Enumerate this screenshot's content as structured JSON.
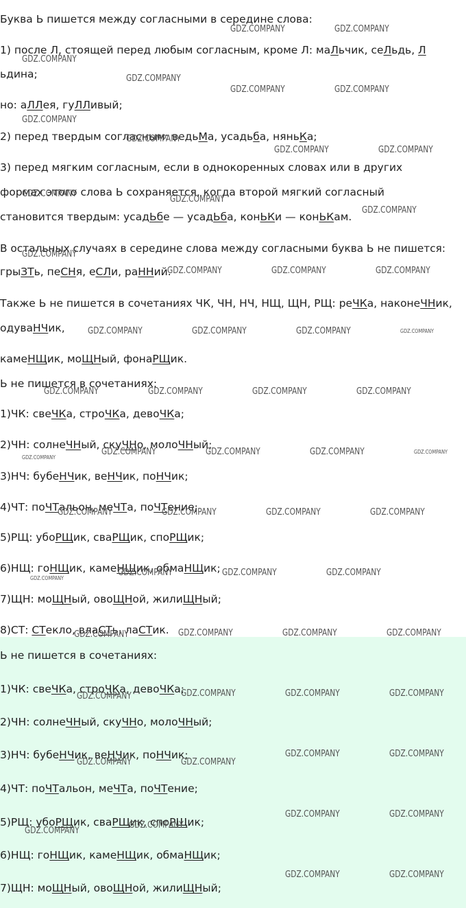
{
  "watermark": "GDZ.COMPANY",
  "lines": [
    [
      {
        "t": "Буква Ь пишется между согласными в середине слова:"
      }
    ],
    [
      {
        "t": "1) после Л, стоящей перед любым согласным, кроме Л: ма"
      },
      {
        "t": "Л",
        "u": 1
      },
      {
        "t": "ьчик, се"
      },
      {
        "t": "Л",
        "u": 1
      },
      {
        "t": "ьдь, "
      },
      {
        "t": "Л",
        "u": 1
      }
    ],
    [
      {
        "t": "ьдина;"
      }
    ],
    [
      {
        "t": "но: а"
      },
      {
        "t": "ЛЛ",
        "u": 1
      },
      {
        "t": "ея, гу"
      },
      {
        "t": "ЛЛ",
        "u": 1
      },
      {
        "t": "ивый;"
      }
    ],
    [
      {
        "t": "2) перед твердым согласным: ведь"
      },
      {
        "t": "М",
        "u": 1
      },
      {
        "t": "а, усадь"
      },
      {
        "t": "б",
        "u": 1
      },
      {
        "t": "а, нянь"
      },
      {
        "t": "К",
        "u": 1
      },
      {
        "t": "а;"
      }
    ],
    [
      {
        "t": "3) перед мягким согласным, если в однокоренных словах или в других"
      }
    ],
    [
      {
        "t": "формах этого слова Ь сохраняется, когда второй мягкий согласный"
      }
    ],
    [
      {
        "t": "становится твердым: усад"
      },
      {
        "t": "Ьб",
        "u": 1
      },
      {
        "t": "е — усад"
      },
      {
        "t": "Ьб",
        "u": 1
      },
      {
        "t": "а, кон"
      },
      {
        "t": "ЬК",
        "u": 1
      },
      {
        "t": "и — кон"
      },
      {
        "t": "ЬК",
        "u": 1
      },
      {
        "t": "ам."
      }
    ],
    [
      {
        "t": "В остальных случаях в середине слова между согласными буква Ь не пишется:"
      }
    ],
    [
      {
        "t": "гры"
      },
      {
        "t": "ЗТ",
        "u": 1
      },
      {
        "t": "ь, пе"
      },
      {
        "t": "СН",
        "u": 1
      },
      {
        "t": "я, е"
      },
      {
        "t": "СЛ",
        "u": 1
      },
      {
        "t": "и, ра"
      },
      {
        "t": "НН",
        "u": 1
      },
      {
        "t": "ий."
      }
    ],
    [
      {
        "t": "Также Ь не пишется в сочетаниях ЧК, ЧН, НЧ, НЩ, ЩН, РЩ: ре"
      },
      {
        "t": "ЧК",
        "u": 1
      },
      {
        "t": "а, наконе"
      },
      {
        "t": "ЧН",
        "u": 1
      },
      {
        "t": "ик,"
      }
    ],
    [
      {
        "t": "одува"
      },
      {
        "t": "НЧ",
        "u": 1
      },
      {
        "t": "ик,"
      }
    ],
    [
      {
        "t": "каме"
      },
      {
        "t": "НЩ",
        "u": 1
      },
      {
        "t": "ик, мо"
      },
      {
        "t": "ЩН",
        "u": 1
      },
      {
        "t": "ый, фона"
      },
      {
        "t": "РЩ",
        "u": 1
      },
      {
        "t": "ик."
      }
    ],
    [
      {
        "t": "Ь не пишется в сочетаниях:"
      }
    ],
    [
      {
        "t": "1)ЧК: све"
      },
      {
        "t": "ЧК",
        "u": 1
      },
      {
        "t": "а, стро"
      },
      {
        "t": "ЧК",
        "u": 1
      },
      {
        "t": "а, дево"
      },
      {
        "t": "ЧК",
        "u": 1
      },
      {
        "t": "а;"
      }
    ],
    [
      {
        "t": "2)ЧН: солне"
      },
      {
        "t": "ЧН",
        "u": 1
      },
      {
        "t": "ый, ску"
      },
      {
        "t": "ЧН",
        "u": 1
      },
      {
        "t": "о, моло"
      },
      {
        "t": "ЧН",
        "u": 1
      },
      {
        "t": "ый;"
      }
    ],
    [
      {
        "t": "3)НЧ: бубе"
      },
      {
        "t": "НЧ",
        "u": 1
      },
      {
        "t": "ик, ве"
      },
      {
        "t": "НЧ",
        "u": 1
      },
      {
        "t": "ик, по"
      },
      {
        "t": "НЧ",
        "u": 1
      },
      {
        "t": "ик;"
      }
    ],
    [
      {
        "t": "4)ЧТ: по"
      },
      {
        "t": "ЧТ",
        "u": 1
      },
      {
        "t": "альон, ме"
      },
      {
        "t": "ЧТ",
        "u": 1
      },
      {
        "t": "а, по"
      },
      {
        "t": "ЧТ",
        "u": 1
      },
      {
        "t": "ение;"
      }
    ],
    [
      {
        "t": "5)РЩ: убо"
      },
      {
        "t": "РЩ",
        "u": 1
      },
      {
        "t": "ик, сва"
      },
      {
        "t": "РЩ",
        "u": 1
      },
      {
        "t": "ик, спо"
      },
      {
        "t": "РЩ",
        "u": 1
      },
      {
        "t": "ик;"
      }
    ],
    [
      {
        "t": "6)НЩ: го"
      },
      {
        "t": "НЩ",
        "u": 1
      },
      {
        "t": "ик, каме"
      },
      {
        "t": "НЩ",
        "u": 1
      },
      {
        "t": "ик, обма"
      },
      {
        "t": "НЩ",
        "u": 1
      },
      {
        "t": "ик;"
      }
    ],
    [
      {
        "t": "7)ЩН: мо"
      },
      {
        "t": "ЩН",
        "u": 1
      },
      {
        "t": "ый, ово"
      },
      {
        "t": "ЩН",
        "u": 1
      },
      {
        "t": "ой, жили"
      },
      {
        "t": "ЩН",
        "u": 1
      },
      {
        "t": "ый;"
      }
    ],
    [
      {
        "t": "8)СТ: "
      },
      {
        "t": "СТ",
        "u": 1
      },
      {
        "t": "екло, вла"
      },
      {
        "t": "СТ",
        "u": 1
      },
      {
        "t": "ь, ла"
      },
      {
        "t": "СТ",
        "u": 1
      },
      {
        "t": "ик."
      }
    ],
    [
      {
        "t": "Ь не пишется в сочетаниях:"
      }
    ],
    [
      {
        "t": "1)ЧК: све"
      },
      {
        "t": "ЧК",
        "u": 1
      },
      {
        "t": "а, стро"
      },
      {
        "t": "ЧК",
        "u": 1
      },
      {
        "t": "а, дево"
      },
      {
        "t": "ЧК",
        "u": 1
      },
      {
        "t": "а;"
      }
    ],
    [
      {
        "t": "2)ЧН: солне"
      },
      {
        "t": "ЧН",
        "u": 1
      },
      {
        "t": "ый, ску"
      },
      {
        "t": "ЧН",
        "u": 1
      },
      {
        "t": "о, моло"
      },
      {
        "t": "ЧН",
        "u": 1
      },
      {
        "t": "ый;"
      }
    ],
    [
      {
        "t": "3)НЧ: бубе"
      },
      {
        "t": "НЧ",
        "u": 1
      },
      {
        "t": "ик, ве"
      },
      {
        "t": "НЧ",
        "u": 1
      },
      {
        "t": "ик, по"
      },
      {
        "t": "НЧ",
        "u": 1
      },
      {
        "t": "ик;"
      }
    ],
    [
      {
        "t": "4)ЧТ: по"
      },
      {
        "t": "ЧТ",
        "u": 1
      },
      {
        "t": "альон, ме"
      },
      {
        "t": "ЧТ",
        "u": 1
      },
      {
        "t": "а, по"
      },
      {
        "t": "ЧТ",
        "u": 1
      },
      {
        "t": "ение;"
      }
    ],
    [
      {
        "t": "5)РЩ: убо"
      },
      {
        "t": "РЩ",
        "u": 1
      },
      {
        "t": "ик, сва"
      },
      {
        "t": "РЩ",
        "u": 1
      },
      {
        "t": "ик, спо"
      },
      {
        "t": "РЩ",
        "u": 1
      },
      {
        "t": "ик;"
      }
    ],
    [
      {
        "t": "6)НЩ: го"
      },
      {
        "t": "НЩ",
        "u": 1
      },
      {
        "t": "ик, каме"
      },
      {
        "t": "НЩ",
        "u": 1
      },
      {
        "t": "ик, обма"
      },
      {
        "t": "НЩ",
        "u": 1
      },
      {
        "t": "ик;"
      }
    ],
    [
      {
        "t": "7)ЩН: мо"
      },
      {
        "t": "ЩН",
        "u": 1
      },
      {
        "t": "ый, ово"
      },
      {
        "t": "ЩН",
        "u": 1
      },
      {
        "t": "ой, жили"
      },
      {
        "t": "ЩН",
        "u": 1
      },
      {
        "t": "ый;"
      }
    ]
  ]
}
